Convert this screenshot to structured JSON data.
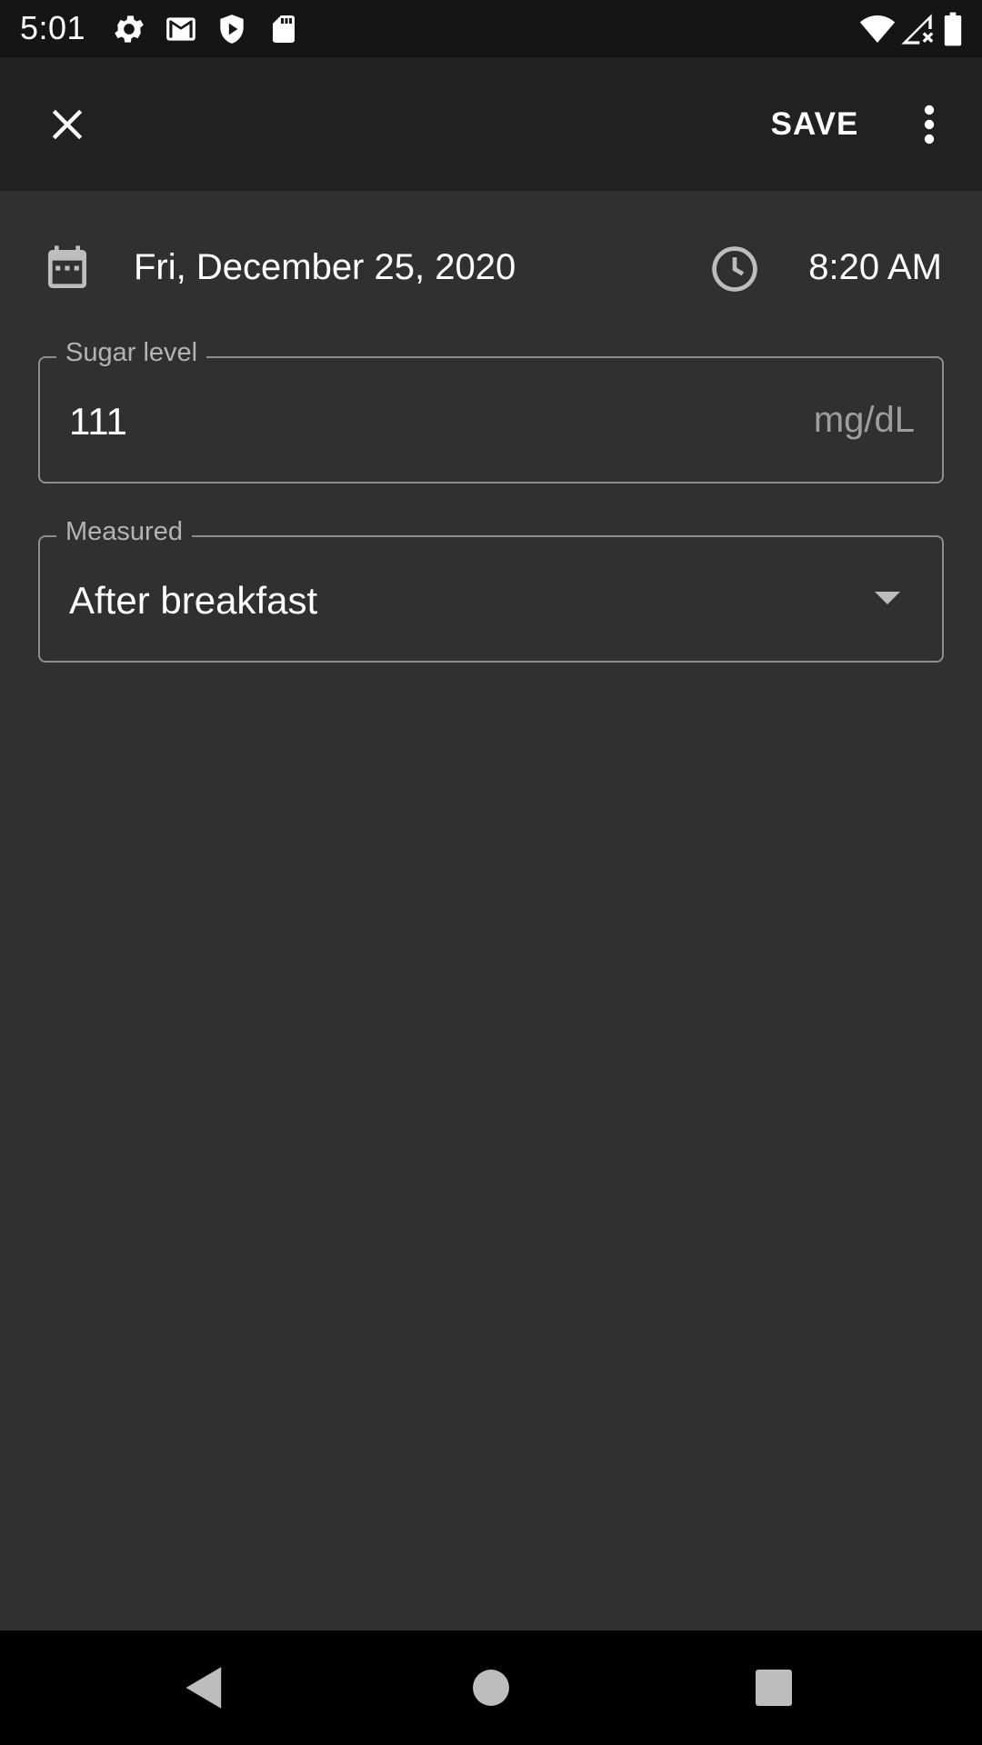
{
  "status_bar": {
    "time": "5:01",
    "left_icons": [
      "gear-icon",
      "gmail-icon",
      "shield-icon",
      "sd-card-icon"
    ],
    "right_icons": [
      "wifi-icon",
      "signal-icon",
      "battery-icon"
    ]
  },
  "app_bar": {
    "close_icon": "close-icon",
    "save_label": "SAVE",
    "more_icon": "more-vert-icon"
  },
  "datetime": {
    "date": "Fri, December 25, 2020",
    "time": "8:20 AM"
  },
  "sugar_field": {
    "label": "Sugar level",
    "value": "111",
    "unit": "mg/dL"
  },
  "measured_field": {
    "label": "Measured",
    "value": "After breakfast"
  },
  "nav_bar": {
    "buttons": [
      "back-icon",
      "home-icon",
      "recents-icon"
    ]
  },
  "colors": {
    "background": "#303030",
    "app_bar": "#212121",
    "status_bar": "#151515",
    "outline": "#8e8e8e"
  }
}
